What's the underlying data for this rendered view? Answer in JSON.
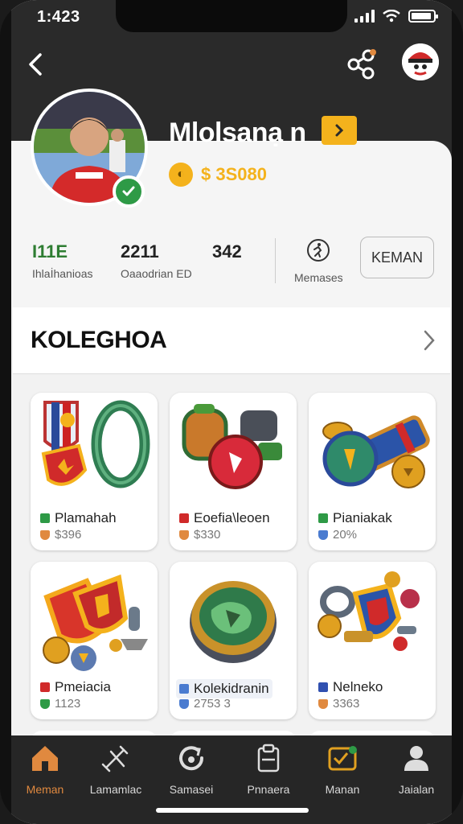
{
  "status_bar": {
    "time": "1:423"
  },
  "profile": {
    "name": "Mlolsanạ n",
    "coin_balance": "$ 3S080",
    "verified": true,
    "follow_button": "KEMAN"
  },
  "stats": [
    {
      "value": "I11E",
      "label": "Ihlaİhanioas"
    },
    {
      "value": "2211",
      "label": "Oaaodrian ED"
    },
    {
      "value": "342",
      "label": ""
    },
    {
      "value": "",
      "label": "Memases"
    }
  ],
  "section": {
    "title": "KOLEGHOA"
  },
  "items": [
    {
      "name": "Plamahah",
      "value": "$396",
      "dot_color": "#2e9a46",
      "shield_color": "#e0893f"
    },
    {
      "name": "Eoefia\\leoen",
      "value": "$330",
      "dot_color": "#d02a2a",
      "shield_color": "#e0893f"
    },
    {
      "name": "Pianiakak",
      "value": "20%",
      "dot_color": "#2e9a46",
      "shield_color": "#4a7bd0"
    },
    {
      "name": "Pmeiacia",
      "value": "1123",
      "dot_color": "#d02a2a",
      "shield_color": "#2e9a46"
    },
    {
      "name": "Kolekidranin",
      "value": "2753 3",
      "dot_color": "#4a7bd0",
      "shield_color": "#4a7bd0"
    },
    {
      "name": "Nelneko",
      "value": "3363",
      "dot_color": "#3050b0",
      "shield_color": "#e0893f"
    }
  ],
  "tabs": [
    {
      "label": "Meman",
      "icon": "home-icon",
      "active": true
    },
    {
      "label": "Lamamlac",
      "icon": "tools-icon",
      "active": false
    },
    {
      "label": "Samasei",
      "icon": "refresh-icon",
      "active": false
    },
    {
      "label": "Pnnaera",
      "icon": "clipboard-icon",
      "active": false
    },
    {
      "label": "Manan",
      "icon": "wallet-icon",
      "active": false
    },
    {
      "label": "Jaialan",
      "icon": "user-icon",
      "active": false
    }
  ],
  "colors": {
    "accent": "#f4b21c",
    "active_tab": "#e0893f",
    "dark": "#2a2a2a"
  }
}
